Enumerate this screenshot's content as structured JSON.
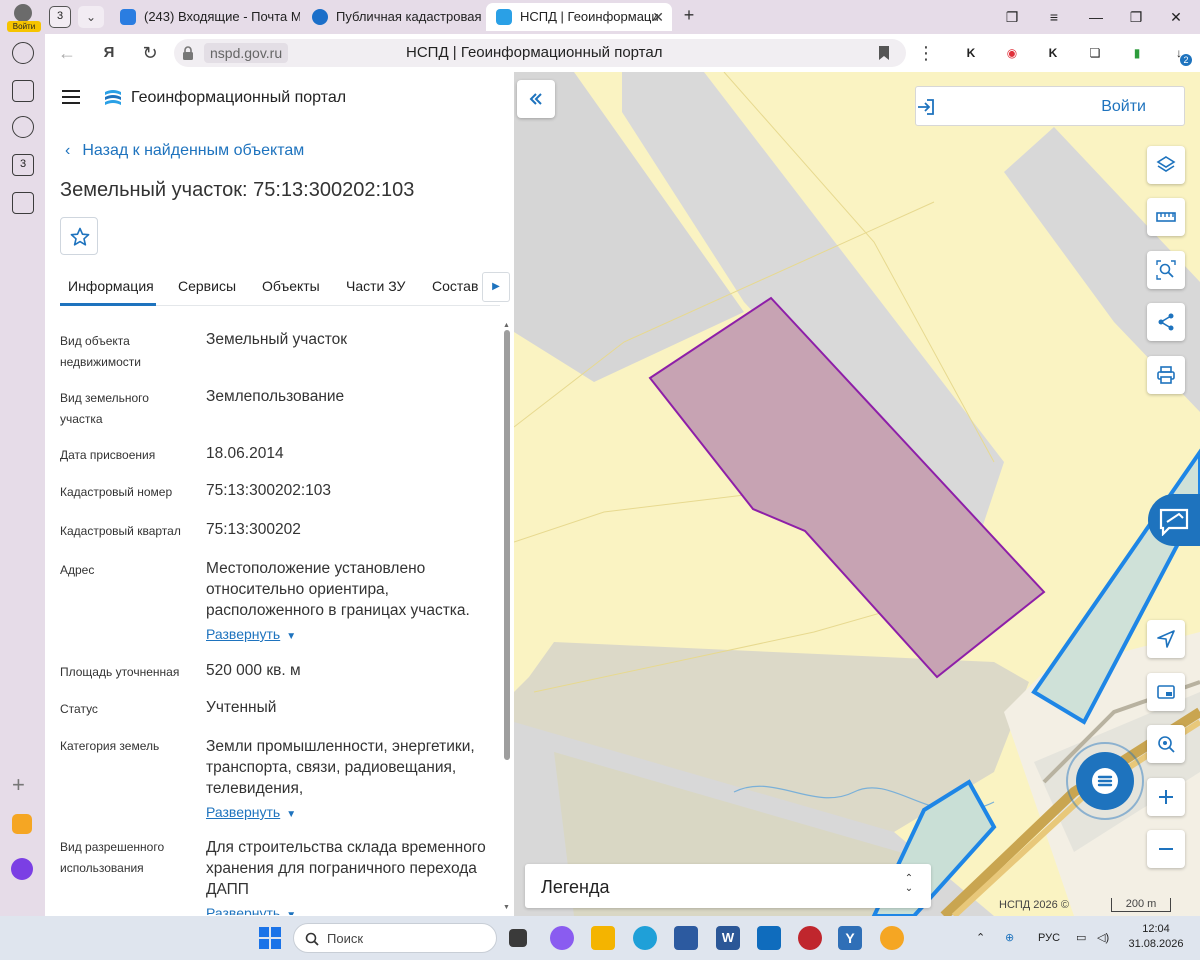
{
  "browser": {
    "profile_label": "Войти",
    "tab_count": "3",
    "tabs": [
      {
        "title": "(243) Входящие - Почта М",
        "icon": "mail-icon"
      },
      {
        "title": "Публичная кадастровая к",
        "icon": "rosreestr-icon"
      },
      {
        "title": "НСПД | Геоинформаци",
        "icon": "nspd-icon",
        "active": true
      }
    ],
    "url_host": "nspd.gov.ru",
    "page_title": "НСПД | Геоинформационный портал",
    "ext_badge": "2",
    "sidebar_badge": "3"
  },
  "panel": {
    "portal_title": "Геоинформационный портал",
    "back_link": "Назад к найденным объектам",
    "object_title": "Земельный участок: 75:13:300202:103",
    "tabs": [
      "Информация",
      "Сервисы",
      "Объекты",
      "Части ЗУ",
      "Состав"
    ],
    "fields": [
      {
        "label": "Вид объекта недвижимости",
        "value": "Земельный участок"
      },
      {
        "label": "Вид земельного участка",
        "value": "Землепользование"
      },
      {
        "label": "Дата присвоения",
        "value": "18.06.2014"
      },
      {
        "label": "Кадастровый номер",
        "value": "75:13:300202:103"
      },
      {
        "label": "Кадастровый квартал",
        "value": "75:13:300202"
      },
      {
        "label": "Адрес",
        "value": "Местоположение установлено относительно ориентира, расположенного в границах участка.",
        "expand": "Развернуть"
      },
      {
        "label": "Площадь уточненная",
        "value": "520 000 кв. м"
      },
      {
        "label": "Статус",
        "value": "Учтенный"
      },
      {
        "label": "Категория земель",
        "value": "Земли промышленности, энергетики, транспорта, связи, радиовещания, телевидения,",
        "expand": "Развернуть"
      },
      {
        "label": "Вид разрешенного использования",
        "value": "Для строительства склада временного хранения для пограничного перехода ДАПП",
        "expand": "Развернуть"
      }
    ]
  },
  "map": {
    "login_label": "Войти",
    "legend_label": "Легенда",
    "copyright": "НСПД 2026 ©",
    "scale": "200 m",
    "colors": {
      "background": "#faf3c2",
      "parcel_fill": "#c7a3b3",
      "parcel_stroke": "#8e1fa8",
      "road": "#d9d9d9",
      "highlight_stroke": "#1e86e6",
      "accent": "#1e73be"
    }
  },
  "taskbar": {
    "search_placeholder": "Поиск",
    "language": "РУС",
    "time": "12:04",
    "date": "31.08.2026"
  }
}
